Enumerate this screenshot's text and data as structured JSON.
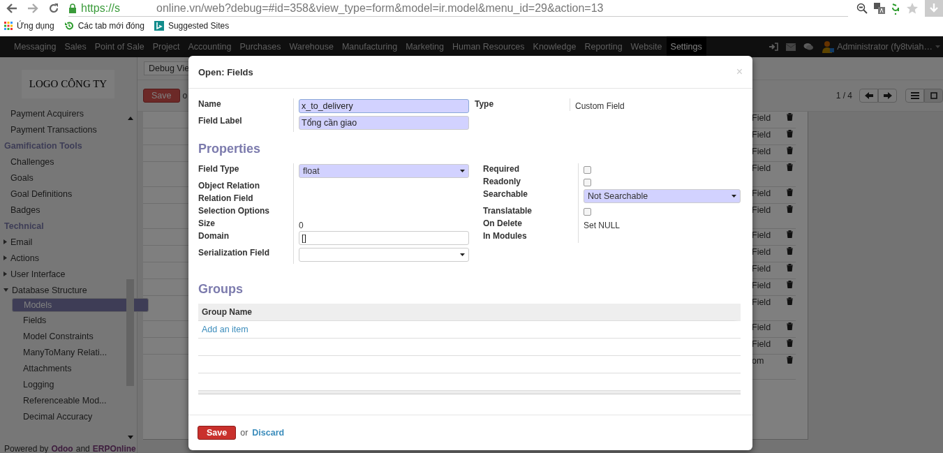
{
  "browser": {
    "url_start": "https://s",
    "url_end": "online.vn/web?debug=#id=358&view_type=form&model=ir.model&menu_id=29&action=13",
    "bookmarks": [
      {
        "label": "Ứng dụng",
        "kind": "apps"
      },
      {
        "label": "Các tab mới đóng",
        "kind": "history"
      },
      {
        "label": "Suggested Sites",
        "kind": "bing"
      }
    ]
  },
  "top_menu": {
    "items": [
      {
        "label": "Messaging",
        "selected": false
      },
      {
        "label": "Sales",
        "selected": false
      },
      {
        "label": "Point of Sale",
        "selected": false
      },
      {
        "label": "Project",
        "selected": false
      },
      {
        "label": "Accounting",
        "selected": false
      },
      {
        "label": "Purchases",
        "selected": false
      },
      {
        "label": "Warehouse",
        "selected": false
      },
      {
        "label": "Manufacturing",
        "selected": false
      },
      {
        "label": "Marketing",
        "selected": false
      },
      {
        "label": "Human Resources",
        "selected": false
      },
      {
        "label": "Knowledge",
        "selected": false
      },
      {
        "label": "Reporting",
        "selected": false
      },
      {
        "label": "Website",
        "selected": false
      },
      {
        "label": "Settings",
        "selected": true
      }
    ],
    "user": "Administrator (fy8tviah…"
  },
  "sidebar": {
    "logo": "LOGO CÔNG TY",
    "sections": [
      {
        "items": [
          {
            "label": "Payment Acquirers",
            "selected": false
          },
          {
            "label": "Payment Transactions",
            "selected": false
          }
        ]
      },
      {
        "title": "Gamification Tools",
        "items": [
          {
            "label": "Challenges",
            "selected": false
          },
          {
            "label": "Goals",
            "selected": false
          },
          {
            "label": "Goal Definitions",
            "selected": false
          },
          {
            "label": "Badges",
            "selected": false
          }
        ]
      },
      {
        "title": "Technical",
        "items": [
          {
            "label": "Email",
            "selected": false,
            "expanded": false
          },
          {
            "label": "Actions",
            "selected": false,
            "expanded": false
          },
          {
            "label": "User Interface",
            "selected": false,
            "expanded": false
          },
          {
            "label": "Database Structure",
            "selected": false,
            "expanded": true,
            "children": [
              {
                "label": "Models",
                "selected": true
              },
              {
                "label": "Fields",
                "selected": false
              },
              {
                "label": "Model Constraints",
                "selected": false
              },
              {
                "label": "ManyToMany Relati...",
                "selected": false
              },
              {
                "label": "Attachments",
                "selected": false
              },
              {
                "label": "Logging",
                "selected": false
              },
              {
                "label": "Referenceable Mod...",
                "selected": false
              },
              {
                "label": "Decimal Accuracy",
                "selected": false
              }
            ]
          }
        ]
      }
    ],
    "powered": [
      {
        "text": "Powered by",
        "link": false
      },
      {
        "text": "Odoo",
        "link": true
      },
      {
        "text": "and",
        "link": false
      },
      {
        "text": "ERPOnline",
        "link": true
      }
    ]
  },
  "background": {
    "view_select": "Debug Vie",
    "save": "Save",
    "or": "o",
    "pager": "1 / 4",
    "rows": [
      {
        "text": "Field",
        "tall": false
      },
      {
        "text": "Field",
        "tall": false
      },
      {
        "text": "Field",
        "tall": false
      },
      {
        "text": "Field",
        "tall": true
      },
      {
        "text": "Field",
        "tall": false
      },
      {
        "text": "Field",
        "tall": true
      },
      {
        "text": "Field",
        "tall": false
      },
      {
        "text": "Field",
        "tall": false
      },
      {
        "text": "Field",
        "tall": false
      },
      {
        "text": "Field",
        "tall": false
      },
      {
        "text": "Field",
        "tall": true
      },
      {
        "text": "Field",
        "tall": false
      },
      {
        "text": "Field",
        "tall": false
      },
      {
        "text": "om",
        "tall": true
      }
    ]
  },
  "dialog": {
    "title": "Open: Fields",
    "close": "×",
    "top_left": [
      {
        "label": "Name",
        "kind": "input",
        "value": "x_to_delivery",
        "required": true,
        "focused": true
      },
      {
        "label": "Field Label",
        "kind": "input",
        "value": "Tổng cần giao",
        "required": true,
        "focused": false
      }
    ],
    "top_right": [
      {
        "label": "Type",
        "kind": "text",
        "value": "Custom Field"
      }
    ],
    "properties_title": "Properties",
    "properties_left": [
      {
        "label": "Field Type",
        "kind": "select",
        "value": "float",
        "required": true
      },
      {
        "label": "Object Relation",
        "kind": "none"
      },
      {
        "label": "Relation Field",
        "kind": "none"
      },
      {
        "label": "Selection Options",
        "kind": "none"
      },
      {
        "label": "Size",
        "kind": "text",
        "value": "0"
      },
      {
        "label": "Domain",
        "kind": "input",
        "value": "[]",
        "required": false,
        "focused": false
      },
      {
        "label": "Serialization Field",
        "kind": "select",
        "required": false
      }
    ],
    "properties_right": [
      {
        "label": "Required",
        "kind": "checkbox",
        "checked": false
      },
      {
        "label": "Readonly",
        "kind": "checkbox",
        "checked": false
      },
      {
        "label": "Searchable",
        "kind": "select",
        "value": "Not Searchable",
        "required": true
      },
      {
        "label": "Translatable",
        "kind": "checkbox",
        "checked": false
      },
      {
        "label": "On Delete",
        "kind": "text",
        "value": "Set NULL"
      },
      {
        "label": "In Modules",
        "kind": "none"
      }
    ],
    "groups_title": "Groups",
    "groups_column": "Group Name",
    "add_item": "Add an item",
    "save": "Save",
    "or": "or",
    "discard": "Discard"
  }
}
